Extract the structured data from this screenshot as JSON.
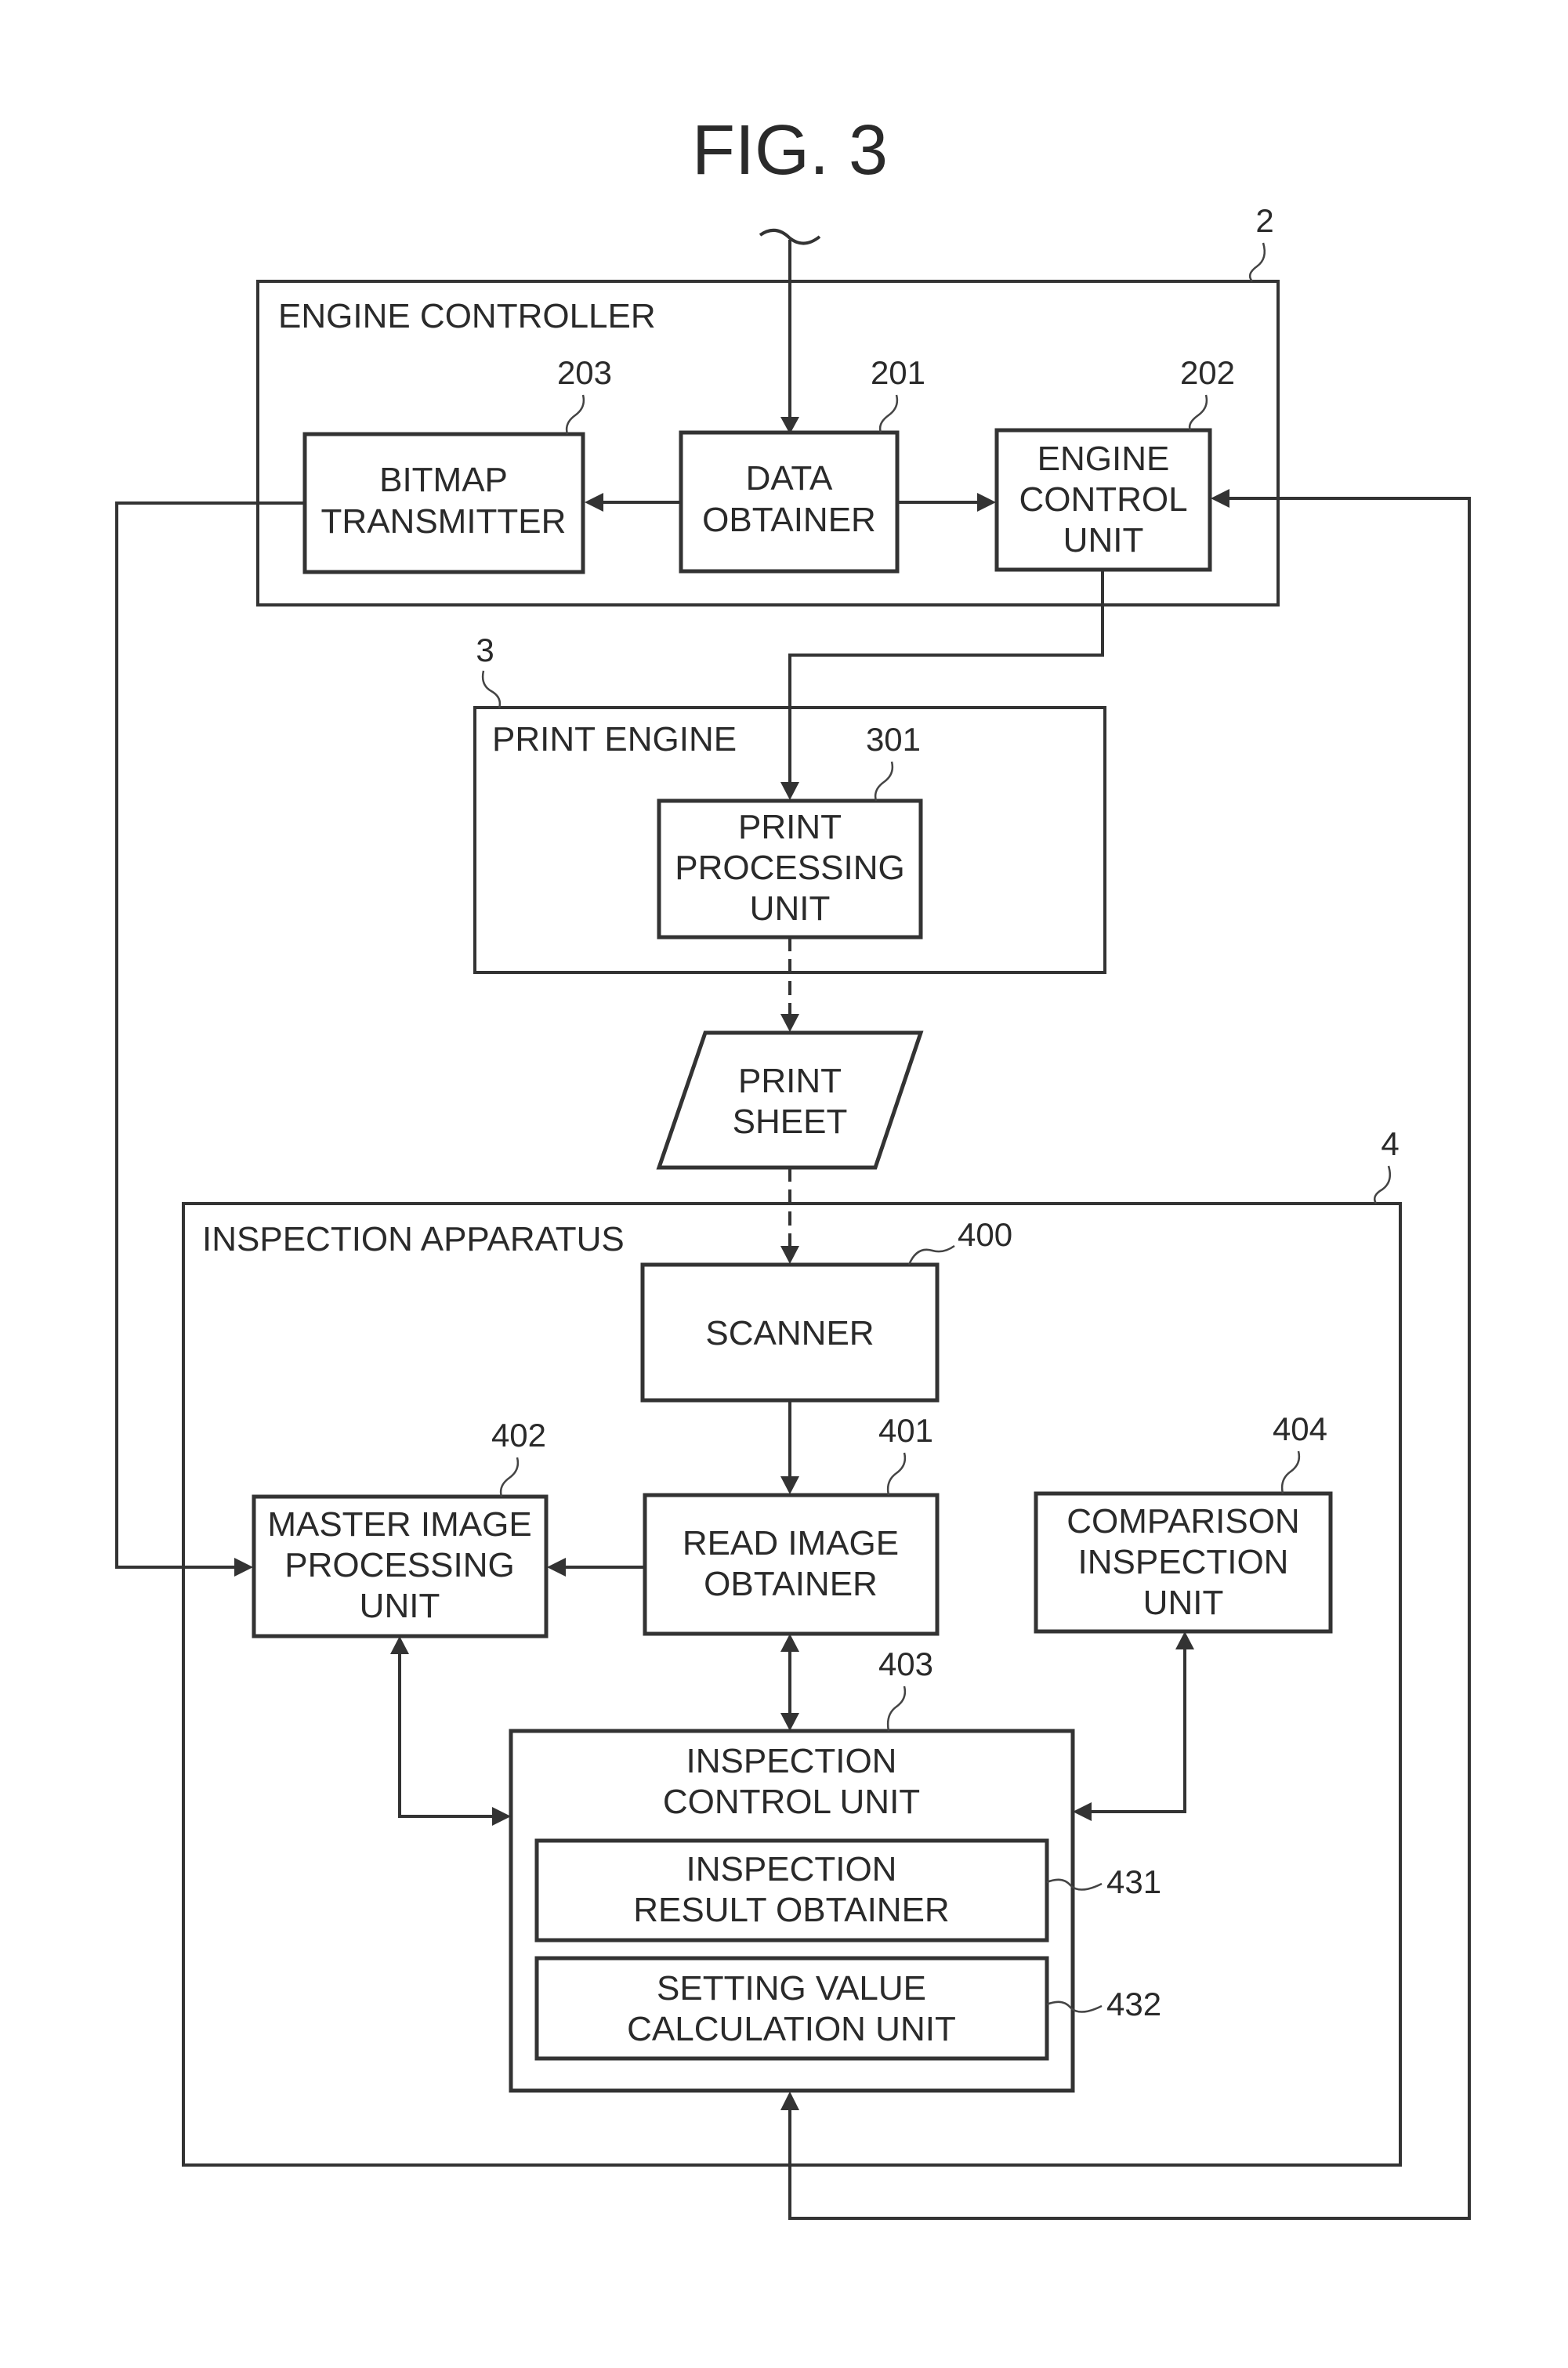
{
  "figure": {
    "title": "FIG. 3"
  },
  "blocks": {
    "engine_controller": {
      "ref": "2",
      "label": "ENGINE CONTROLLER"
    },
    "bitmap_transmitter": {
      "ref": "203",
      "lines": [
        "BITMAP",
        "TRANSMITTER"
      ]
    },
    "data_obtainer": {
      "ref": "201",
      "lines": [
        "DATA",
        "OBTAINER"
      ]
    },
    "engine_control_unit": {
      "ref": "202",
      "lines": [
        "ENGINE",
        "CONTROL",
        "UNIT"
      ]
    },
    "print_engine": {
      "ref": "3",
      "label": "PRINT ENGINE"
    },
    "print_processing_unit": {
      "ref": "301",
      "lines": [
        "PRINT",
        "PROCESSING",
        "UNIT"
      ]
    },
    "print_sheet": {
      "lines": [
        "PRINT",
        "SHEET"
      ]
    },
    "inspection_apparatus": {
      "ref": "4",
      "label": "INSPECTION APPARATUS"
    },
    "scanner": {
      "ref": "400",
      "lines": [
        "SCANNER"
      ]
    },
    "master_image_processing_unit": {
      "ref": "402",
      "lines": [
        "MASTER IMAGE",
        "PROCESSING",
        "UNIT"
      ]
    },
    "read_image_obtainer": {
      "ref": "401",
      "lines": [
        "READ IMAGE",
        "OBTAINER"
      ]
    },
    "comparison_inspection_unit": {
      "ref": "404",
      "lines": [
        "COMPARISON",
        "INSPECTION",
        "UNIT"
      ]
    },
    "inspection_control_unit": {
      "ref": "403",
      "lines": [
        "INSPECTION",
        "CONTROL UNIT"
      ]
    },
    "inspection_result_obtainer": {
      "ref": "431",
      "lines": [
        "INSPECTION",
        "RESULT OBTAINER"
      ]
    },
    "setting_value_calculation_unit": {
      "ref": "432",
      "lines": [
        "SETTING VALUE",
        "CALCULATION UNIT"
      ]
    }
  }
}
